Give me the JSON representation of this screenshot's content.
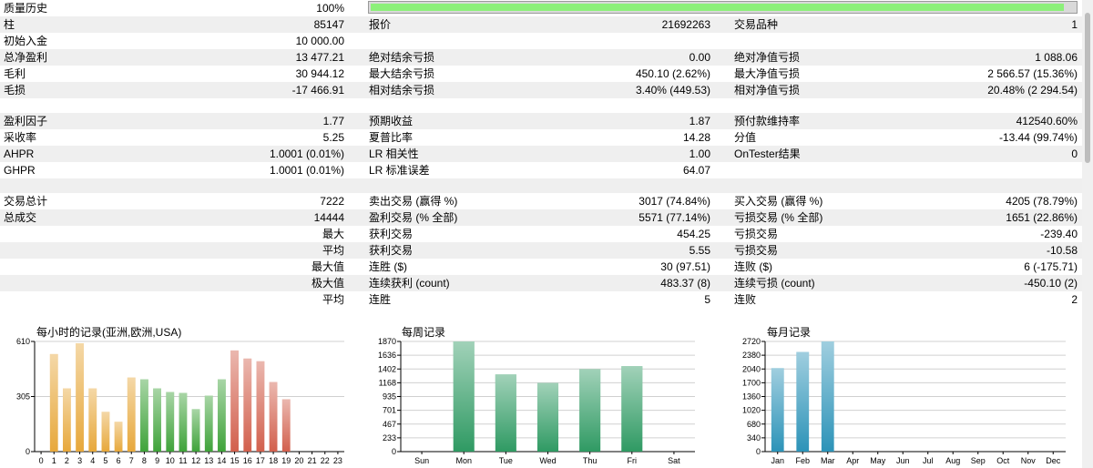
{
  "sections": [
    [
      {
        "l1": "质量历史",
        "v1": "100%",
        "quality": {
          "fraction": 0.985,
          "color": "#8cf07a"
        }
      },
      {
        "l1": "柱",
        "v1": "85147",
        "l2": "报价",
        "v2": "21692263",
        "l3": "交易品种",
        "v3": "1"
      },
      {
        "l1": "初始入金",
        "v1": "10 000.00"
      },
      {
        "l1": "总净盈利",
        "v1": "13 477.21",
        "l2": "绝对结余亏损",
        "v2": "0.00",
        "l3": "绝对净值亏损",
        "v3": "1 088.06"
      },
      {
        "l1": "毛利",
        "v1": "30 944.12",
        "l2": "最大结余亏损",
        "v2": "450.10 (2.62%)",
        "l3": "最大净值亏损",
        "v3": "2 566.57 (15.36%)"
      },
      {
        "l1": "毛损",
        "v1": "-17 466.91",
        "l2": "相对结余亏损",
        "v2": "3.40% (449.53)",
        "l3": "相对净值亏损",
        "v3": "20.48% (2 294.54)"
      }
    ],
    [
      {
        "l1": "盈利因子",
        "v1": "1.77",
        "l2": "预期收益",
        "v2": "1.87",
        "l3": "预付款维持率",
        "v3": "412540.60%"
      },
      {
        "l1": "采收率",
        "v1": "5.25",
        "l2": "夏普比率",
        "v2": "14.28",
        "l3": "分值",
        "v3": "-13.44 (99.74%)"
      },
      {
        "l1": "AHPR",
        "v1": "1.0001 (0.01%)",
        "l2": "LR 相关性",
        "v2": "1.00",
        "l3": "OnTester结果",
        "v3": "0"
      },
      {
        "l1": "GHPR",
        "v1": "1.0001 (0.01%)",
        "l2": "LR 标准误差",
        "v2": "64.07"
      }
    ],
    [
      {
        "l1": "交易总计",
        "v1": "7222",
        "l2": "卖出交易 (赢得 %)",
        "v2": "3017 (74.84%)",
        "l3": "买入交易 (赢得 %)",
        "v3": "4205 (78.79%)"
      },
      {
        "l1": "总成交",
        "v1": "14444",
        "l2": "盈利交易 (% 全部)",
        "v2": "5571 (77.14%)",
        "l3": "亏损交易 (% 全部)",
        "v3": "1651 (22.86%)"
      },
      {
        "rl": "最大",
        "l2": "获利交易",
        "v2": "454.25",
        "l3": "亏损交易",
        "v3": "-239.40"
      },
      {
        "rl": "平均",
        "l2": "获利交易",
        "v2": "5.55",
        "l3": "亏损交易",
        "v3": "-10.58"
      },
      {
        "rl": "最大值",
        "l2": "连胜 ($)",
        "v2": "30 (97.51)",
        "l3": "连败 ($)",
        "v3": "6 (-175.71)"
      },
      {
        "rl": "极大值",
        "l2": "连续获利 (count)",
        "v2": "483.37 (8)",
        "l3": "连续亏损 (count)",
        "v3": "-450.10 (2)"
      },
      {
        "rl": "平均",
        "l2": "连胜",
        "v2": "5",
        "l3": "连败",
        "v3": "2"
      }
    ]
  ],
  "chart_data": [
    {
      "type": "bar",
      "title": "每小时的记录(亚洲,欧洲,USA)",
      "categories": [
        "0",
        "1",
        "2",
        "3",
        "4",
        "5",
        "6",
        "7",
        "8",
        "9",
        "10",
        "11",
        "12",
        "13",
        "14",
        "15",
        "16",
        "17",
        "18",
        "19",
        "20",
        "21",
        "22",
        "23"
      ],
      "values": [
        0,
        540,
        350,
        600,
        350,
        220,
        165,
        410,
        400,
        350,
        330,
        325,
        235,
        310,
        400,
        560,
        515,
        500,
        385,
        290,
        0,
        0,
        0,
        0
      ],
      "yticks": [
        "0",
        "305",
        "610"
      ],
      "ylim": [
        0,
        610
      ],
      "colors": [
        "#e7a83b",
        "#e7a83b",
        "#e7a83b",
        "#e7a83b",
        "#e7a83b",
        "#e7a83b",
        "#e7a83b",
        "#e7a83b",
        "#3fa33a",
        "#3fa33a",
        "#3fa33a",
        "#3fa33a",
        "#3fa33a",
        "#3fa33a",
        "#3fa33a",
        "#d2604d",
        "#d2604d",
        "#d2604d",
        "#d2604d",
        "#d2604d",
        "#d2604d",
        "#d2604d",
        "#d2604d",
        "#d2604d"
      ]
    },
    {
      "type": "bar",
      "title": "每周记录",
      "categories": [
        "Sun",
        "Mon",
        "Tue",
        "Wed",
        "Thu",
        "Fri",
        "Sat"
      ],
      "values": [
        0,
        1870,
        1310,
        1165,
        1400,
        1450,
        0
      ],
      "yticks": [
        "0",
        "233",
        "467",
        "701",
        "935",
        "1168",
        "1402",
        "1636",
        "1870"
      ],
      "ylim": [
        0,
        1870
      ],
      "color": "#2f9a63"
    },
    {
      "type": "bar",
      "title": "每月记录",
      "categories": [
        "Jan",
        "Feb",
        "Mar",
        "Apr",
        "May",
        "Jun",
        "Jul",
        "Aug",
        "Sep",
        "Oct",
        "Nov",
        "Dec"
      ],
      "values": [
        2060,
        2460,
        2720,
        0,
        0,
        0,
        0,
        0,
        0,
        0,
        0,
        0
      ],
      "yticks": [
        "0",
        "340",
        "680",
        "1020",
        "1360",
        "1700",
        "2040",
        "2380",
        "2720"
      ],
      "ylim": [
        0,
        2720
      ],
      "color": "#2c93b8"
    }
  ]
}
